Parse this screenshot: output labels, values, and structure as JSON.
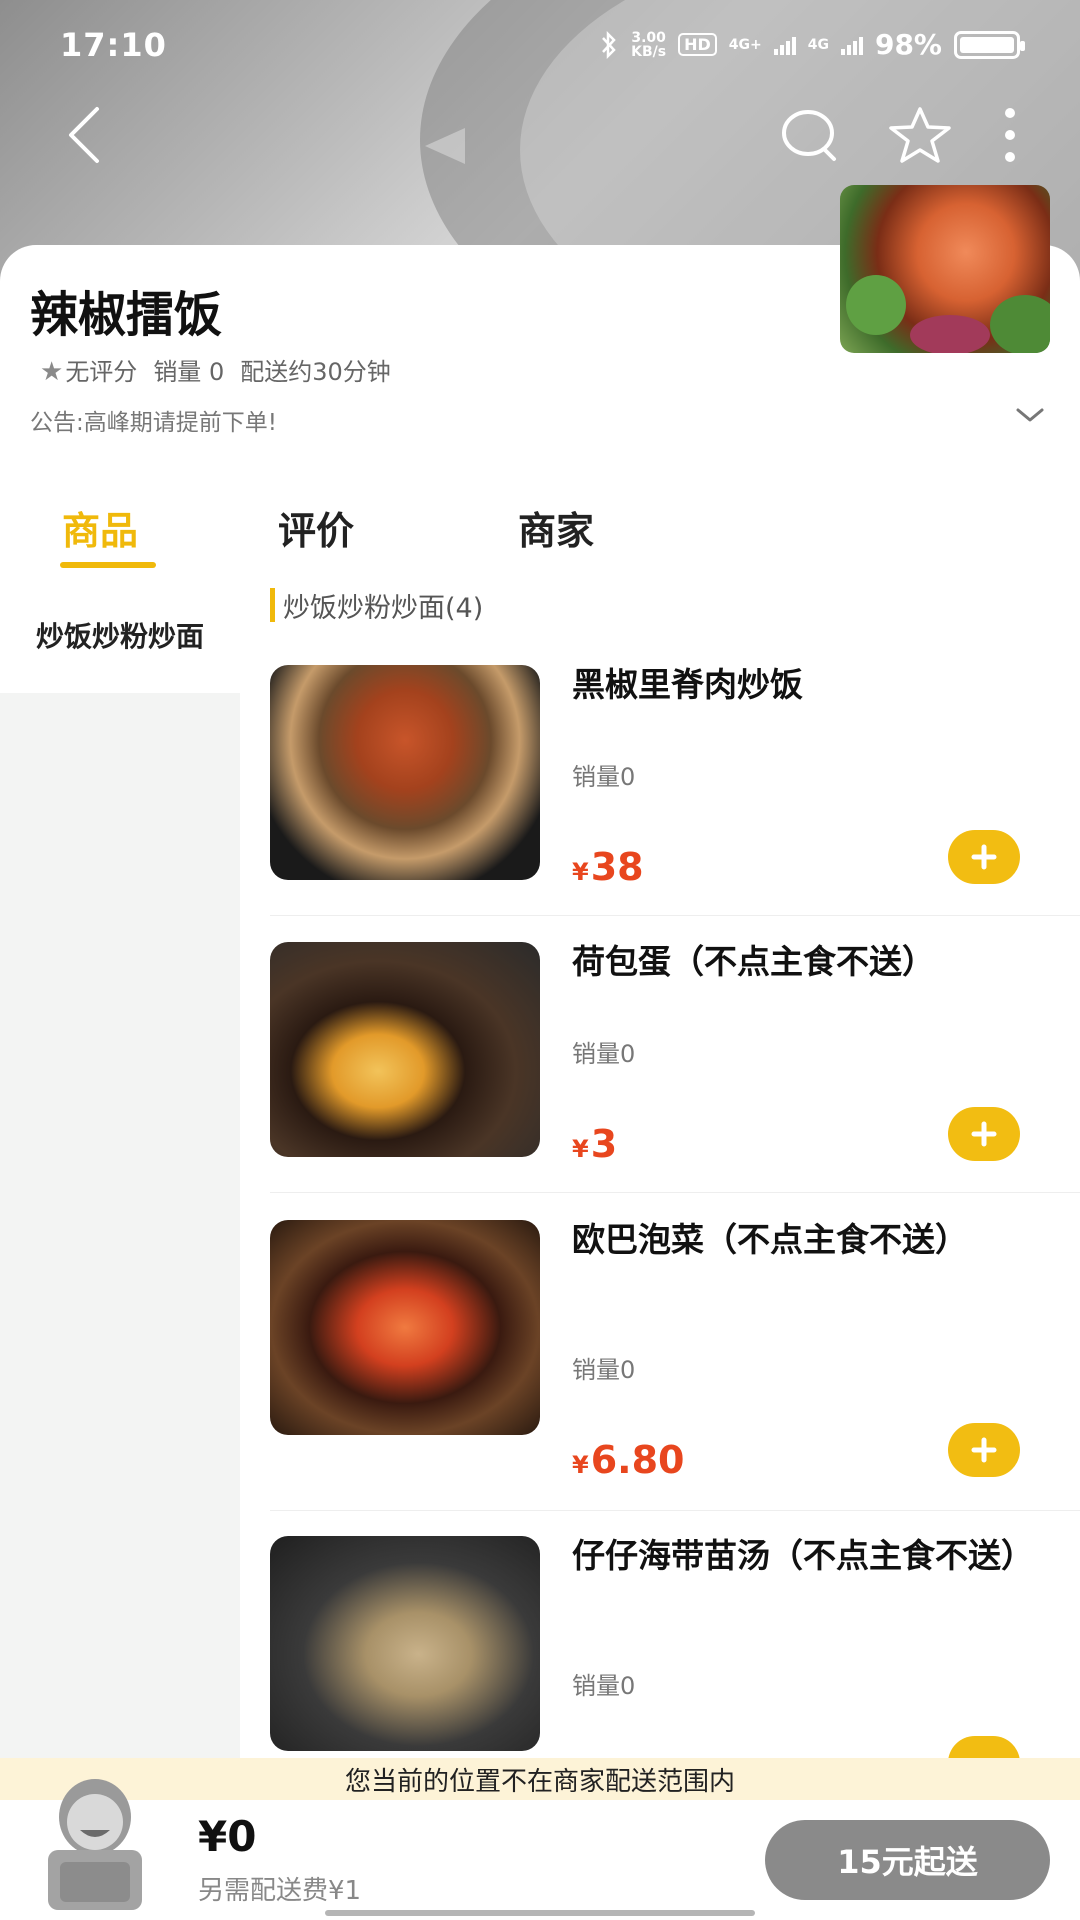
{
  "status_bar": {
    "time": "17:10",
    "net_speed": "3.00",
    "net_unit": "KB/s",
    "hd": "HD",
    "sim1": "4G+",
    "sim2": "4G",
    "battery": "98%"
  },
  "nav": {
    "back_icon": "chevron-left-icon",
    "search_icon": "search-icon",
    "star_icon": "star-icon",
    "more_icon": "more-vertical-icon"
  },
  "shop": {
    "name": "辣椒擂饭",
    "rating": "无评分",
    "sales": "销量 0",
    "delivery": "配送约30分钟",
    "notice": "公告:高峰期请提前下单!"
  },
  "tabs": [
    {
      "label": "商品"
    },
    {
      "label": "评价"
    },
    {
      "label": "商家"
    }
  ],
  "sidebar": {
    "items": [
      {
        "label": "炒饭炒粉炒面"
      }
    ]
  },
  "category": {
    "label": "炒饭炒粉炒面(4)"
  },
  "products": [
    {
      "name": "黑椒里脊肉炒饭",
      "sales": "销量0",
      "currency": "¥",
      "price": "38"
    },
    {
      "name": "荷包蛋（不点主食不送）",
      "sales": "销量0",
      "currency": "¥",
      "price": "3"
    },
    {
      "name": "欧巴泡菜（不点主食不送）",
      "sales": "销量0",
      "currency": "¥",
      "price": "6.80"
    },
    {
      "name": "仔仔海带苗汤（不点主食不送）",
      "sales": "销量0",
      "currency": "¥",
      "price": ""
    }
  ],
  "range_notice": "您当前的位置不在商家配送范围内",
  "cart": {
    "total": "¥0",
    "delivery_fee": "另需配送费¥1",
    "checkout_label": "15元起送"
  },
  "colors": {
    "accent": "#f0b90b",
    "price": "#e8461e",
    "disabled": "#8a8a8a",
    "notice_bg": "#fdf3d7"
  }
}
